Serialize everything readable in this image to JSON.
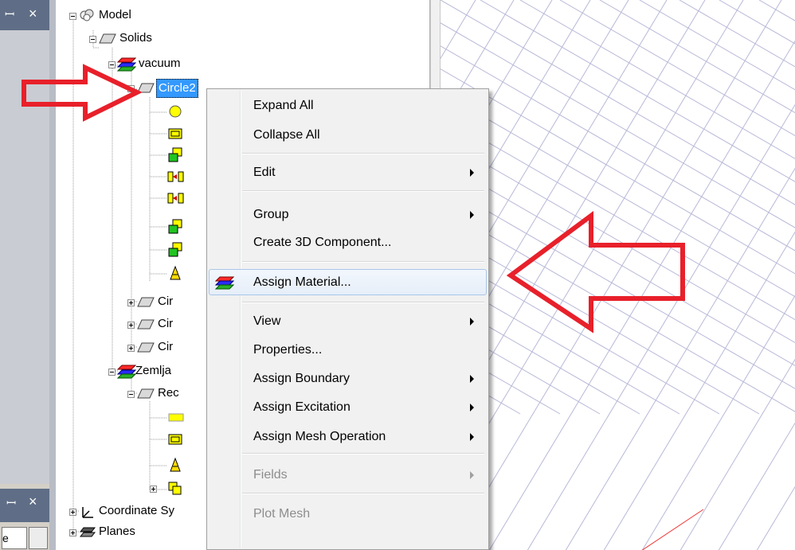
{
  "tree": {
    "model_label": "Model",
    "solids_label": "Solids",
    "vacuum_label": "vacuum",
    "selected_label": "Circle2",
    "circle_children": [
      "Cir",
      "Cir",
      "Cir"
    ],
    "zemlja_label": "Zemlja",
    "rect_label": "Rec",
    "coordinate_label": "Coordinate Sy",
    "planes_label": "Planes"
  },
  "panes": {
    "pin_glyph": "ꟷ",
    "close_glyph": "×",
    "field_text": "e"
  },
  "menu": {
    "items": [
      {
        "label": "Expand All",
        "submenu": false,
        "disabled": false
      },
      {
        "label": "Collapse All",
        "submenu": false,
        "disabled": false
      },
      {
        "label": "Edit",
        "submenu": true,
        "disabled": false
      },
      {
        "label": "Group",
        "submenu": true,
        "disabled": false
      },
      {
        "label": "Create 3D Component...",
        "submenu": false,
        "disabled": false
      },
      {
        "label": "Assign Material...",
        "submenu": false,
        "disabled": false
      },
      {
        "label": "View",
        "submenu": true,
        "disabled": false
      },
      {
        "label": "Properties...",
        "submenu": false,
        "disabled": false
      },
      {
        "label": "Assign Boundary",
        "submenu": true,
        "disabled": false
      },
      {
        "label": "Assign Excitation",
        "submenu": true,
        "disabled": false
      },
      {
        "label": "Assign Mesh Operation",
        "submenu": true,
        "disabled": false
      },
      {
        "label": "Fields",
        "submenu": true,
        "disabled": true
      },
      {
        "label": "Plot Mesh",
        "submenu": false,
        "disabled": true
      }
    ],
    "highlighted": "Assign Material..."
  },
  "colors": {
    "annotation_arrow": "#e8202a",
    "selection": "#3399ff",
    "grid": "#b8b8d8"
  }
}
